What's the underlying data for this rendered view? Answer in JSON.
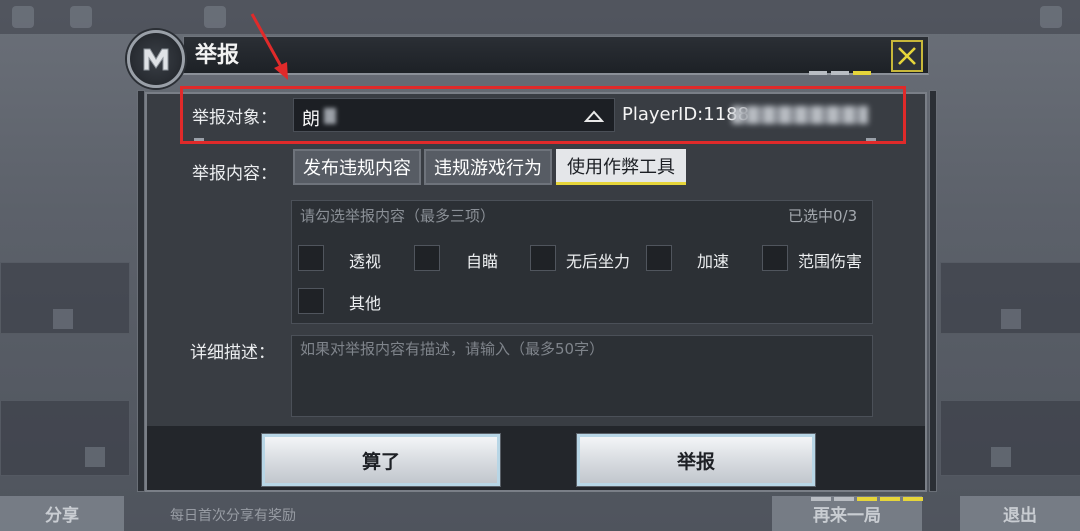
{
  "background": {
    "left_tab": "分享",
    "bottom_strip": "每日首次分享有奖励",
    "play_again": "再来一局",
    "exit": "退出"
  },
  "dialog": {
    "title": "举报",
    "close_icon": "close-x-icon",
    "accent_color": "#e6d53a",
    "report_target": {
      "label": "举报对象：",
      "value": "朗",
      "player_id": "PlayerID:1188"
    },
    "report_content": {
      "label": "举报内容：",
      "tabs": [
        {
          "label": "发布违规内容",
          "active": false
        },
        {
          "label": "违规游戏行为",
          "active": false
        },
        {
          "label": "使用作弊工具",
          "active": true
        }
      ],
      "hint": "请勾选举报内容（最多三项）",
      "selected_count": "已选中0/3",
      "options": [
        "透视",
        "自瞄",
        "无后坐力",
        "加速",
        "范围伤害",
        "其他"
      ]
    },
    "details": {
      "label": "详细描述：",
      "placeholder": "如果对举报内容有描述，请输入（最多50字）"
    },
    "buttons": {
      "cancel": "算了",
      "submit": "举报"
    }
  },
  "annotation": {
    "box_color": "#e02a2a"
  }
}
